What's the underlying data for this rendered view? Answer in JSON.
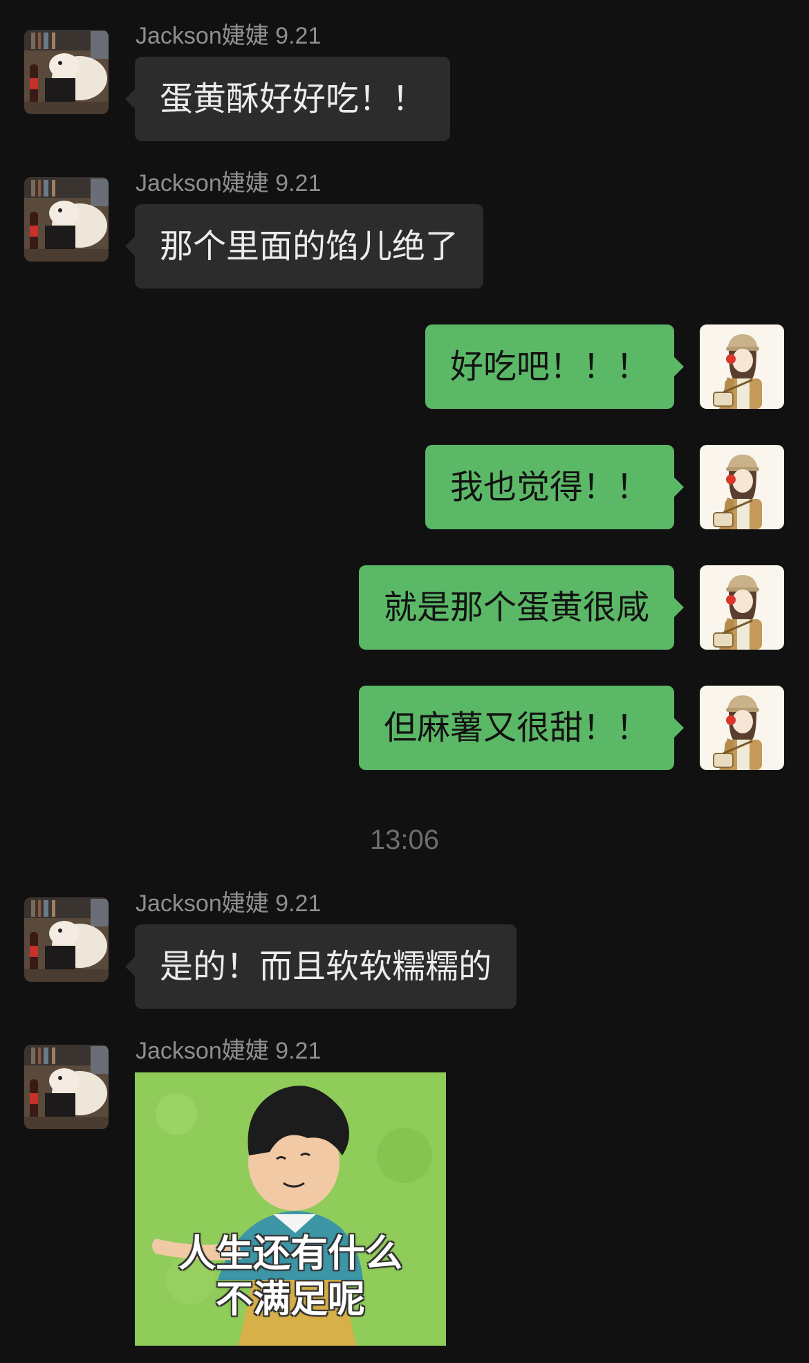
{
  "messages": [
    {
      "sender": "Jackson婕婕 9.21",
      "text": "蛋黄酥好好吃！！"
    },
    {
      "sender": "Jackson婕婕 9.21",
      "text": "那个里面的馅儿绝了"
    },
    {
      "text": "好吃吧！！！"
    },
    {
      "text": "我也觉得！！"
    },
    {
      "text": "就是那个蛋黄很咸"
    },
    {
      "text": "但麻薯又很甜！！"
    },
    {
      "sender": "Jackson婕婕 9.21",
      "text": "是的！而且软软糯糯的"
    },
    {
      "sender": "Jackson婕婕 9.21",
      "sticker_lines": [
        "人生还有什么",
        "不满足呢"
      ]
    }
  ],
  "timestamp": "13:06",
  "colors": {
    "background": "#111111",
    "incoming_bubble": "#2c2c2c",
    "outgoing_bubble": "#5bb867",
    "sender_name": "#8f8f8f",
    "timestamp": "#6e6e6e"
  },
  "icons": {
    "contact_avatar": "contact-avatar-photo",
    "self_avatar": "self-avatar-illustration",
    "sticker": "boy-sticker-image"
  }
}
